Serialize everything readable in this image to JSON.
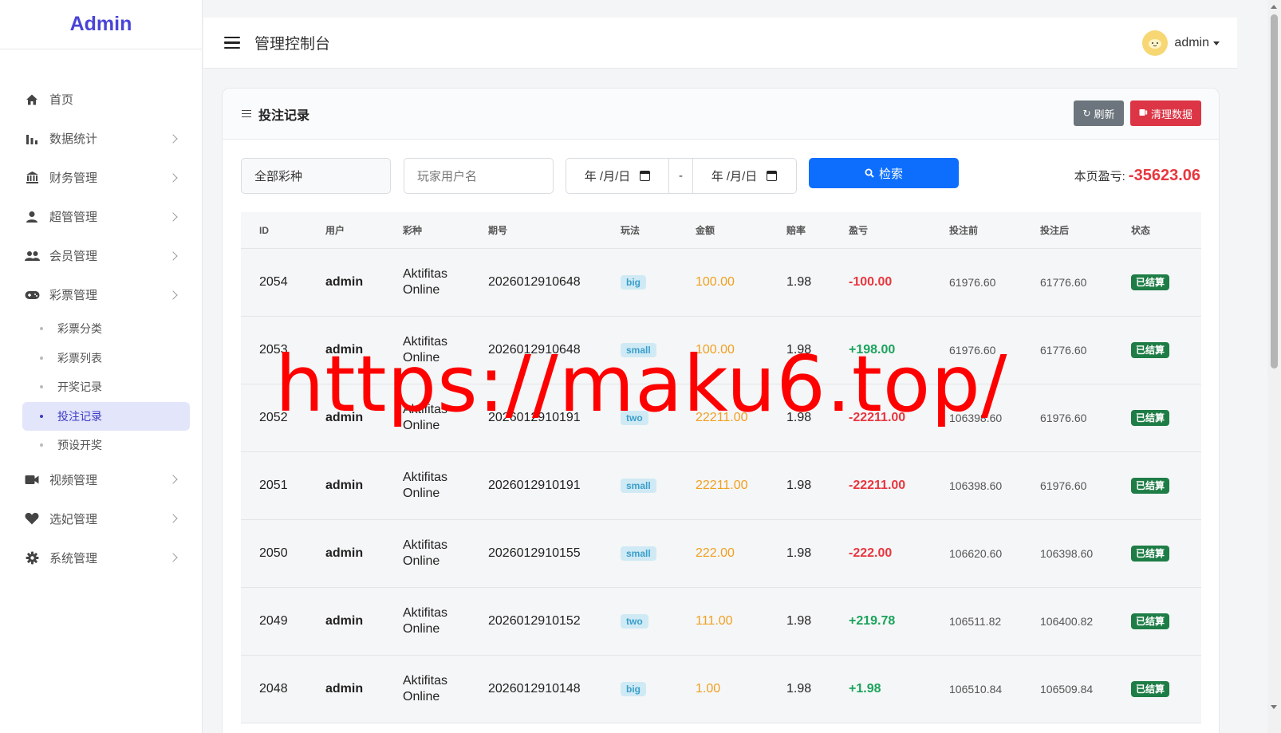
{
  "brand": "Admin",
  "sidebar": {
    "items": [
      {
        "label": "首页",
        "icon": "home-icon",
        "chevron": false
      },
      {
        "label": "数据统计",
        "icon": "bar-chart-icon",
        "chevron": true
      },
      {
        "label": "财务管理",
        "icon": "bank-icon",
        "chevron": true
      },
      {
        "label": "超管管理",
        "icon": "person-icon",
        "chevron": true
      },
      {
        "label": "会员管理",
        "icon": "people-icon",
        "chevron": true
      },
      {
        "label": "彩票管理",
        "icon": "gamepad-icon",
        "chevron": true
      }
    ],
    "sub_items": [
      {
        "label": "彩票分类",
        "active": false
      },
      {
        "label": "彩票列表",
        "active": false
      },
      {
        "label": "开奖记录",
        "active": false
      },
      {
        "label": "投注记录",
        "active": true
      },
      {
        "label": "预设开奖",
        "active": false
      }
    ],
    "items_after": [
      {
        "label": "视频管理",
        "icon": "video-icon",
        "chevron": true
      },
      {
        "label": "选妃管理",
        "icon": "heart-icon",
        "chevron": true
      },
      {
        "label": "系统管理",
        "icon": "gear-icon",
        "chevron": true
      }
    ]
  },
  "header": {
    "title": "管理控制台",
    "user": "admin"
  },
  "card": {
    "title": "投注记录",
    "refresh_label": "刷新",
    "clear_label": "清理数据"
  },
  "filters": {
    "lottery_value": "全部彩种",
    "player_placeholder": "玩家用户名",
    "date_start": "年 /月/日",
    "date_sep": "-",
    "date_end": "年 /月/日",
    "search_label": "检索",
    "profit_label": "本页盈亏: ",
    "profit_value": "-35623.06"
  },
  "table": {
    "headers": [
      "ID",
      "用户",
      "彩种",
      "期号",
      "玩法",
      "金额",
      "赔率",
      "盈亏",
      "投注前",
      "投注后",
      "状态"
    ],
    "rows": [
      {
        "id": "2054",
        "user": "admin",
        "lottery1": "Aktifitas",
        "lottery2": "Online",
        "period": "2026012910648",
        "play": "big",
        "amount": "100.00",
        "odds": "1.98",
        "profit": "-100.00",
        "before": "61976.60",
        "after": "61776.60",
        "status": "已结算"
      },
      {
        "id": "2053",
        "user": "admin",
        "lottery1": "Aktifitas",
        "lottery2": "Online",
        "period": "2026012910648",
        "play": "small",
        "amount": "100.00",
        "odds": "1.98",
        "profit": "+198.00",
        "before": "61976.60",
        "after": "61776.60",
        "status": "已结算"
      },
      {
        "id": "2052",
        "user": "admin",
        "lottery1": "Aktifitas",
        "lottery2": "Online",
        "period": "2026012910191",
        "play": "two",
        "amount": "22211.00",
        "odds": "1.98",
        "profit": "-22211.00",
        "before": "106398.60",
        "after": "61976.60",
        "status": "已结算"
      },
      {
        "id": "2051",
        "user": "admin",
        "lottery1": "Aktifitas",
        "lottery2": "Online",
        "period": "2026012910191",
        "play": "small",
        "amount": "22211.00",
        "odds": "1.98",
        "profit": "-22211.00",
        "before": "106398.60",
        "after": "61976.60",
        "status": "已结算"
      },
      {
        "id": "2050",
        "user": "admin",
        "lottery1": "Aktifitas",
        "lottery2": "Online",
        "period": "2026012910155",
        "play": "small",
        "amount": "222.00",
        "odds": "1.98",
        "profit": "-222.00",
        "before": "106620.60",
        "after": "106398.60",
        "status": "已结算"
      },
      {
        "id": "2049",
        "user": "admin",
        "lottery1": "Aktifitas",
        "lottery2": "Online",
        "period": "2026012910152",
        "play": "two",
        "amount": "111.00",
        "odds": "1.98",
        "profit": "+219.78",
        "before": "106511.82",
        "after": "106400.82",
        "status": "已结算"
      },
      {
        "id": "2048",
        "user": "admin",
        "lottery1": "Aktifitas",
        "lottery2": "Online",
        "period": "2026012910148",
        "play": "big",
        "amount": "1.00",
        "odds": "1.98",
        "profit": "+1.98",
        "before": "106510.84",
        "after": "106509.84",
        "status": "已结算"
      }
    ]
  },
  "watermark": "https://maku6.top/"
}
